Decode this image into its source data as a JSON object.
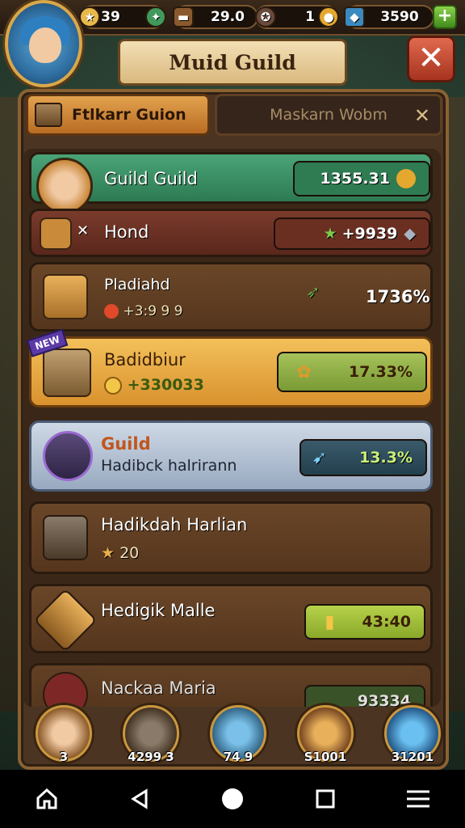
{
  "topbar": {
    "res1_value": "39",
    "res2_value": "29.0",
    "res3_value": "1",
    "res4_value": "3590",
    "plus_label": "+"
  },
  "header": {
    "title": "Muid Guild",
    "close_label": "✕"
  },
  "tabs": {
    "active_label": "Ftlkarr Guion",
    "inactive_label": "Maskarn Wobm",
    "close_label": "✕"
  },
  "rows": [
    {
      "name": "Guild Guild",
      "value": "1355.31"
    },
    {
      "name": "Hond",
      "value": "+9939"
    },
    {
      "name": "Pladiahd",
      "sub": "+3:9 9 9",
      "value": "1736%"
    },
    {
      "name": "Badidbiur",
      "sub": "+330033",
      "value": "17.33%",
      "badge": "NEW"
    },
    {
      "name": "Guild",
      "sub": "Hadibck halrirann",
      "value": "13.3%"
    },
    {
      "name": "Hadikdah Harlian",
      "sub": "20"
    },
    {
      "name": "Hedigik Malle",
      "value": "43:40"
    },
    {
      "name": "Nackaa Maria",
      "value": "93334"
    }
  ],
  "dock": {
    "item1": "3",
    "item2": "4299 3",
    "item3": "74 9",
    "item4": "S1001",
    "item5": "31201"
  },
  "colors": {
    "accent_green": "#3f9a6b",
    "accent_gold": "#e9b04d",
    "panel": "#4b3421"
  }
}
